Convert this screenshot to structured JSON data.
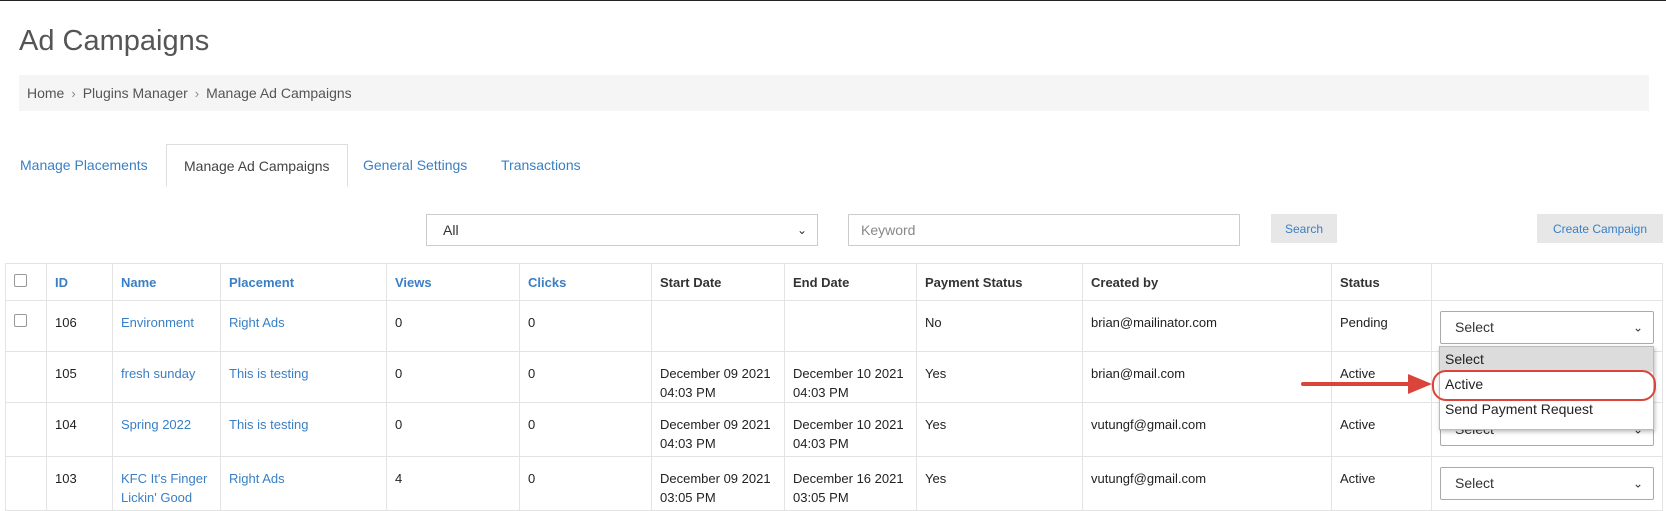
{
  "page": {
    "title": "Ad Campaigns"
  },
  "breadcrumb": [
    "Home",
    "Plugins Manager",
    "Manage Ad Campaigns"
  ],
  "tabs": [
    {
      "label": "Manage Placements",
      "active": false
    },
    {
      "label": "Manage Ad Campaigns",
      "active": true
    },
    {
      "label": "General Settings",
      "active": false
    },
    {
      "label": "Transactions",
      "active": false
    }
  ],
  "filters": {
    "placement_select": "All",
    "keyword_placeholder": "Keyword",
    "search_label": "Search",
    "create_label": "Create Campaign"
  },
  "table": {
    "headers": {
      "id": "ID",
      "name": "Name",
      "placement": "Placement",
      "views": "Views",
      "clicks": "Clicks",
      "start": "Start Date",
      "end": "End Date",
      "payment": "Payment Status",
      "created": "Created by",
      "status": "Status"
    },
    "rows": [
      {
        "id": "106",
        "name": "Environment",
        "placement": "Right Ads",
        "views": "0",
        "clicks": "0",
        "start": "",
        "end": "",
        "payment": "No",
        "created": "brian@mailinator.com",
        "status": "Pending",
        "action": "Select"
      },
      {
        "id": "105",
        "name": "fresh sunday",
        "placement": "This is testing",
        "views": "0",
        "clicks": "0",
        "start": "December 09 2021 04:03 PM",
        "end": "December 10 2021 04:03 PM",
        "payment": "Yes",
        "created": "brian@mail.com",
        "status": "Active",
        "action": "Select"
      },
      {
        "id": "104",
        "name": "Spring 2022",
        "placement": "This is testing",
        "views": "0",
        "clicks": "0",
        "start": "December 09 2021 04:03 PM",
        "end": "December 10 2021 04:03 PM",
        "payment": "Yes",
        "created": "vutungf@gmail.com",
        "status": "Active",
        "action": "Select"
      },
      {
        "id": "103",
        "name": "KFC It's Finger Lickin' Good",
        "placement": "Right Ads",
        "views": "4",
        "clicks": "0",
        "start": "December 09 2021 03:05 PM",
        "end": "December 16 2021 03:05 PM",
        "payment": "Yes",
        "created": "vutungf@gmail.com",
        "status": "Active",
        "action": "Select"
      }
    ]
  },
  "dropdown": {
    "options": [
      "Select",
      "Active",
      "Send Payment Request"
    ],
    "highlighted": "Select",
    "annotated": "Active"
  },
  "colors": {
    "link": "#3a7fc4",
    "annotation": "#d9453b"
  }
}
